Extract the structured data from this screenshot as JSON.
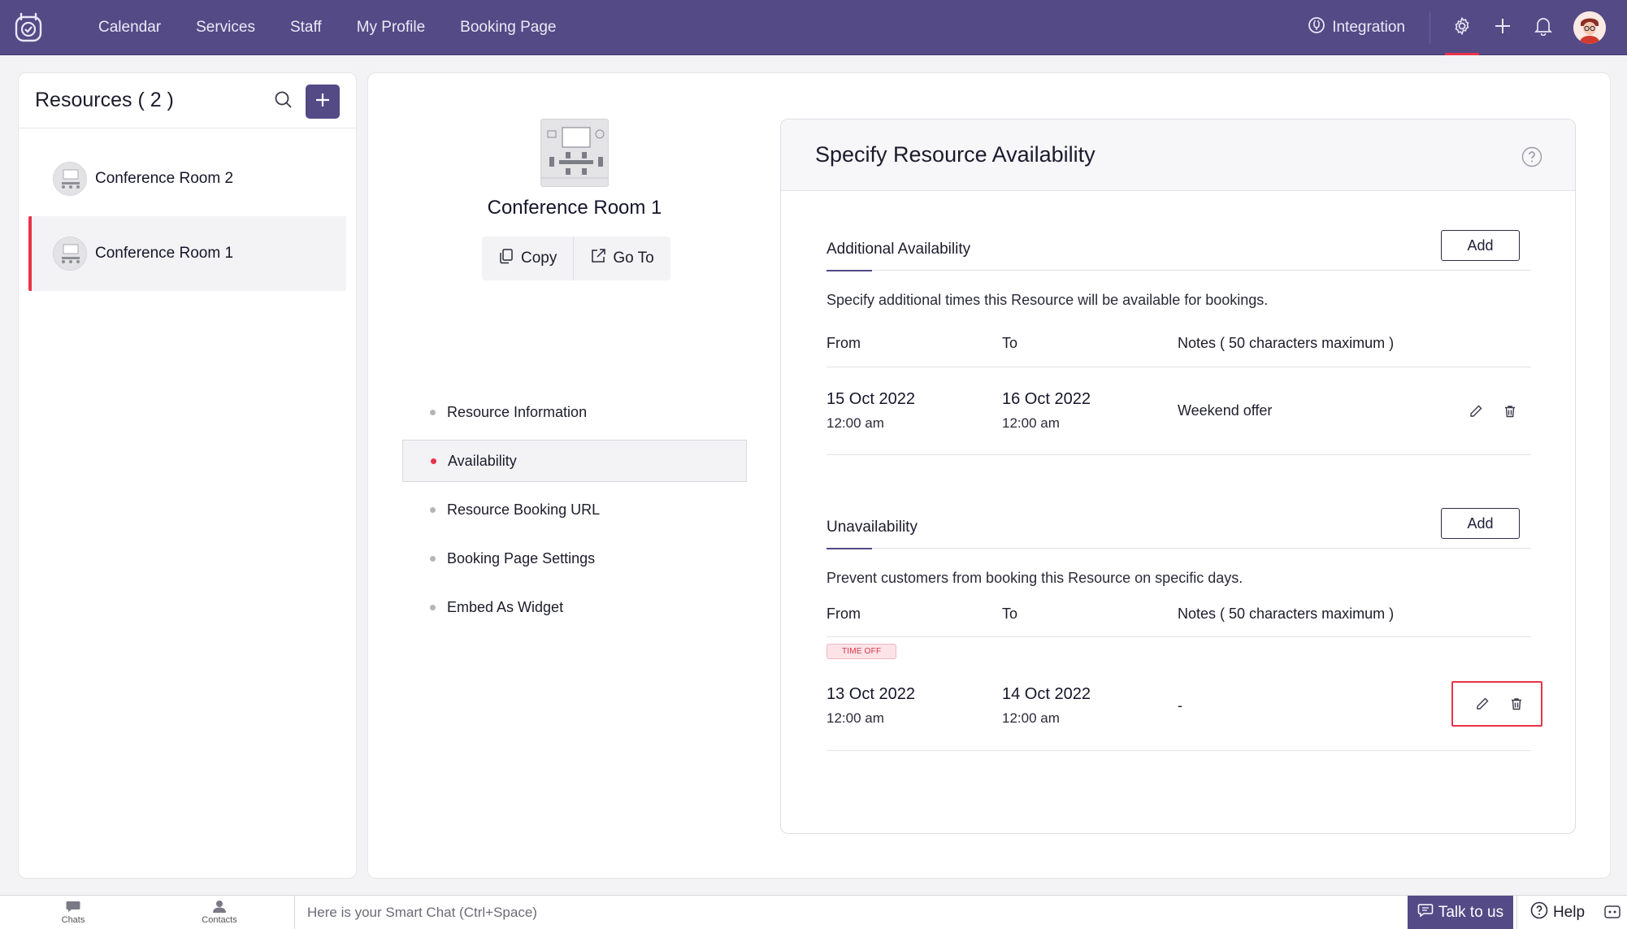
{
  "nav": {
    "items": [
      "Calendar",
      "Services",
      "Staff",
      "My Profile",
      "Booking Page"
    ],
    "integration": "Integration"
  },
  "icons": {
    "logo": "app-logo-icon",
    "integration": "integration-icon",
    "settings": "gear-icon",
    "add": "plus-icon",
    "notifications": "bell-icon",
    "search": "search-icon",
    "copy": "copy-icon",
    "goto": "external-link-icon",
    "help": "question-circle-icon",
    "edit": "pencil-icon",
    "delete": "trash-icon"
  },
  "colors": {
    "brand": "#534a86",
    "accent": "#e8334a"
  },
  "sidebar": {
    "title": "Resources ( 2 )",
    "items": [
      {
        "label": "Conference Room 2",
        "active": false
      },
      {
        "label": "Conference Room 1",
        "active": true
      }
    ]
  },
  "resource": {
    "title": "Conference Room 1",
    "copy_label": "Copy",
    "goto_label": "Go To",
    "menu": [
      {
        "label": "Resource Information",
        "active": false
      },
      {
        "label": "Availability",
        "active": true
      },
      {
        "label": "Resource Booking URL",
        "active": false
      },
      {
        "label": "Booking Page Settings",
        "active": false
      },
      {
        "label": "Embed As Widget",
        "active": false
      }
    ]
  },
  "availability": {
    "title": "Specify Resource Availability",
    "additional": {
      "title": "Additional Availability",
      "add_label": "Add",
      "description": "Specify additional times this Resource will be available for bookings.",
      "columns": [
        "From",
        "To",
        "Notes ( 50 characters maximum )"
      ],
      "rows": [
        {
          "from_date": "15 Oct 2022",
          "from_time": "12:00 am",
          "to_date": "16 Oct 2022",
          "to_time": "12:00 am",
          "notes": "Weekend offer"
        }
      ]
    },
    "unavailability": {
      "title": "Unavailability",
      "add_label": "Add",
      "description": "Prevent customers from booking this Resource on specific days.",
      "columns": [
        "From",
        "To",
        "Notes ( 50 characters maximum )"
      ],
      "badge": "TIME OFF",
      "rows": [
        {
          "from_date": "13 Oct 2022",
          "from_time": "12:00 am",
          "to_date": "14 Oct 2022",
          "to_time": "12:00 am",
          "notes": "-"
        }
      ]
    }
  },
  "bottombar": {
    "chats": "Chats",
    "contacts": "Contacts",
    "smart_chat_placeholder": "Here is your Smart Chat (Ctrl+Space)",
    "talk": "Talk to us",
    "help": "Help"
  }
}
